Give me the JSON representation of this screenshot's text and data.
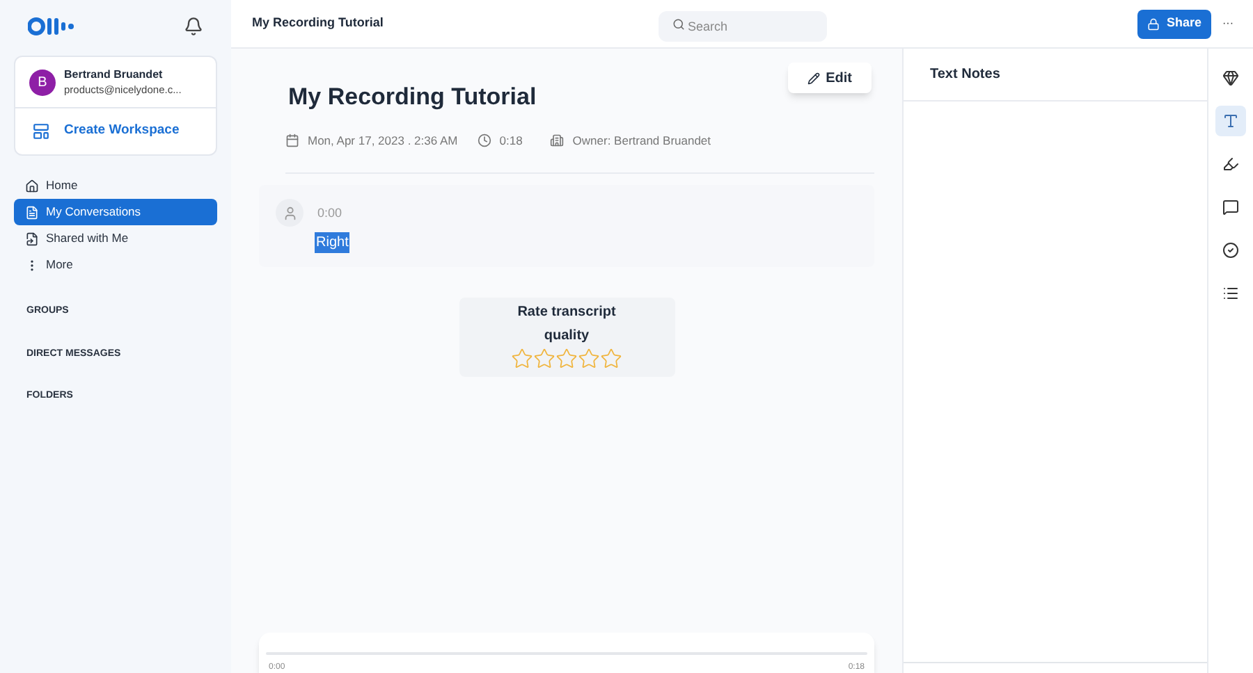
{
  "user": {
    "initial": "B",
    "name": "Bertrand Bruandet",
    "email": "products@nicelydone.c..."
  },
  "workspace": {
    "label": "Create Workspace"
  },
  "nav": [
    {
      "kind": "home",
      "label": "Home",
      "selected": false
    },
    {
      "kind": "conversations",
      "label": "My Conversations",
      "selected": true
    },
    {
      "kind": "shared",
      "label": "Shared with Me",
      "selected": false
    },
    {
      "kind": "more",
      "label": "More",
      "selected": false
    }
  ],
  "sections": [
    "GROUPS",
    "DIRECT MESSAGES",
    "FOLDERS"
  ],
  "header": {
    "title": "My Recording Tutorial",
    "search_placeholder": "Search",
    "share": "Share",
    "more": "···"
  },
  "conversation": {
    "title": "My Recording Tutorial",
    "edit": "Edit",
    "date": "Mon, Apr 17, 2023 . 2:36 AM",
    "duration": "0:18",
    "owner": "Owner: Bertrand Bruandet"
  },
  "transcript": [
    {
      "time": "0:00",
      "text": "Right",
      "selected": true
    }
  ],
  "rating": {
    "label": "Rate transcript quality",
    "stars": 0
  },
  "player": {
    "level": 0,
    "start": "0:00",
    "end": "0:18"
  },
  "notes": {
    "title": "Text Notes"
  },
  "rail": [
    {
      "kind": "diamond",
      "selected": false
    },
    {
      "kind": "text",
      "selected": true
    },
    {
      "kind": "marker",
      "selected": false
    },
    {
      "kind": "comment",
      "selected": false
    },
    {
      "kind": "tasks",
      "selected": false
    },
    {
      "kind": "list",
      "selected": false
    }
  ]
}
